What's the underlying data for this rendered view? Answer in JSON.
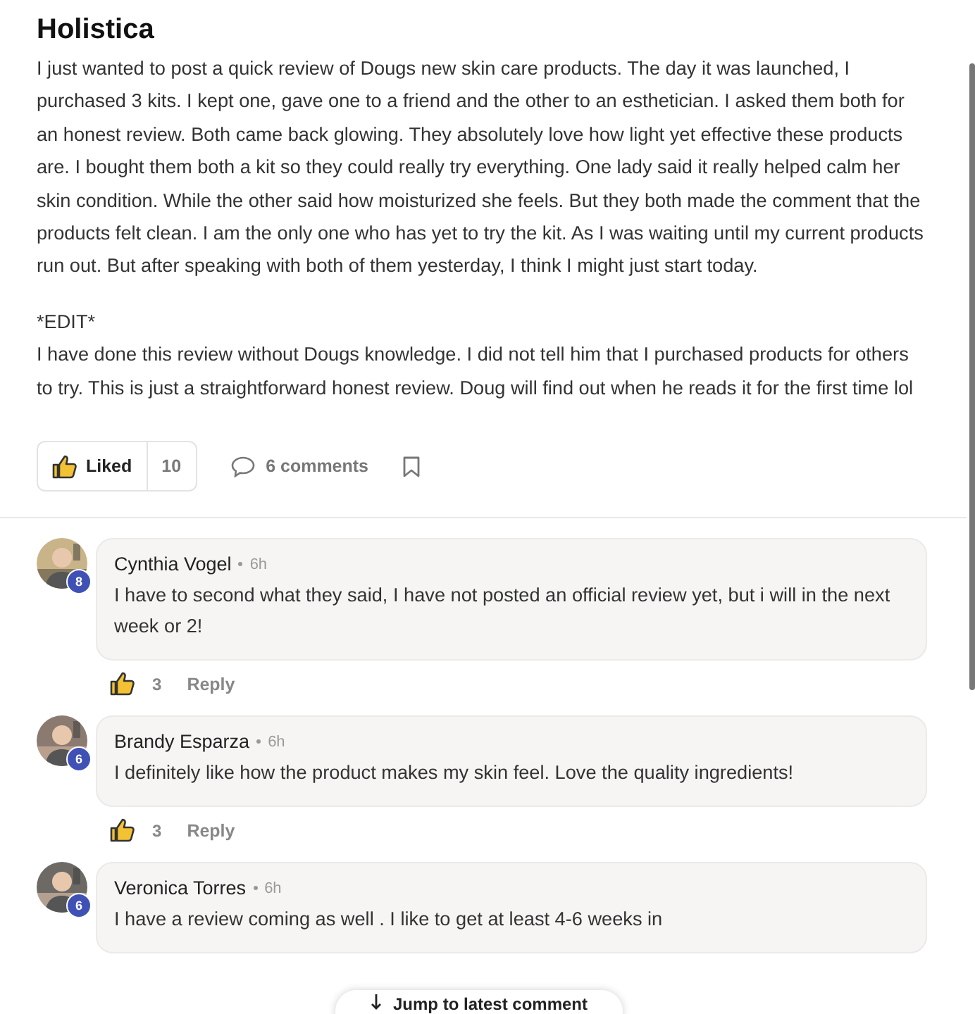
{
  "post": {
    "author": "Holistica",
    "paragraphs": [
      "I just wanted to post a quick review of Dougs new skin care products. The day it was launched, I purchased 3 kits. I kept one, gave one to a friend and the other to an esthetician. I asked them both for an honest review. Both came back glowing. They absolutely love how light yet effective these products are. I bought them both a kit so they could really try everything. One lady said it really helped calm her skin condition. While the other said how moisturized she feels. But they both made the comment that the products felt clean. I am the only one who has yet to try the kit. As I was waiting until my current products run out. But after speaking with both of them yesterday, I think I might just start today.",
      "*EDIT*\nI have done this review without Dougs knowledge. I did not tell him that I purchased products for others to try. This is just a straightforward honest review. Doug will find out when he reads it for the first time lol"
    ],
    "like_label": "Liked",
    "liked": true,
    "like_count": "10",
    "comments_label": "6 comments"
  },
  "comments": [
    {
      "name": "Cynthia Vogel",
      "time": "6h",
      "badge": "8",
      "text": "I have to second what they said, I have not posted an official review yet, but i will in the next week or 2!",
      "likes": "3",
      "reply": "Reply"
    },
    {
      "name": "Brandy Esparza",
      "time": "6h",
      "badge": "6",
      "text": "I definitely like how the product makes my skin feel. Love the quality ingredients!",
      "likes": "3",
      "reply": "Reply"
    },
    {
      "name": "Veronica Torres",
      "time": "6h",
      "badge": "6",
      "text": "I have a review coming as well . I like to get at least 4-6 weeks in"
    }
  ],
  "jump_button": "Jump to latest comment"
}
